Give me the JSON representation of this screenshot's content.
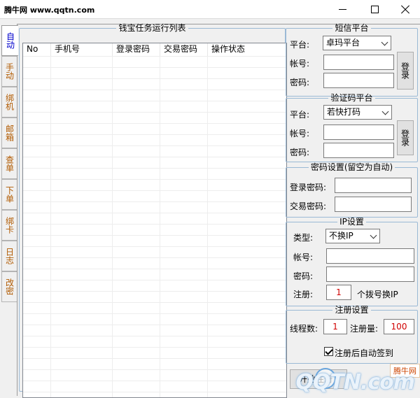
{
  "window": {
    "title": "腾牛网 www.qqtn.com"
  },
  "tabs": [
    {
      "label": "自动",
      "active": true
    },
    {
      "label": "手动"
    },
    {
      "label": "绑机"
    },
    {
      "label": "邮箱"
    },
    {
      "label": "查单"
    },
    {
      "label": "下单"
    },
    {
      "label": "绑卡"
    },
    {
      "label": "日志"
    },
    {
      "label": "改密"
    }
  ],
  "task_list": {
    "title": "钱宝任务运行列表",
    "columns": [
      "No",
      "手机号",
      "登录密码",
      "交易密码",
      "操作状态"
    ]
  },
  "sms_platform": {
    "title": "短信平台",
    "platform_label": "平台:",
    "platform_value": "卓玛平台",
    "account_label": "帐号:",
    "account_value": "",
    "password_label": "密码:",
    "password_value": "",
    "login_button": "登录"
  },
  "captcha_platform": {
    "title": "验证码平台",
    "platform_label": "平台:",
    "platform_value": "若快打码",
    "account_label": "帐号:",
    "account_value": "",
    "password_label": "密码:",
    "password_value": "",
    "login_button": "登录"
  },
  "password_settings": {
    "title": "密码设置(留空为自动)",
    "login_label": "登录密码:",
    "login_value": "",
    "trade_label": "交易密码:",
    "trade_value": ""
  },
  "ip_settings": {
    "title": "IP设置",
    "type_label": "类型:",
    "type_value": "不换IP",
    "account_label": "帐号:",
    "account_value": "",
    "password_label": "密码:",
    "password_value": "",
    "register_label": "注册:",
    "register_value": "1",
    "register_suffix": "个拨号换IP"
  },
  "register_settings": {
    "title": "注册设置",
    "threads_label": "线程数:",
    "threads_value": "1",
    "count_label": "注册量:",
    "count_value": "100",
    "auto_checkin_label": "注册后自动签到",
    "auto_checkin_checked": true
  },
  "bottom": {
    "start_button": "开始注册"
  },
  "watermark": {
    "badge": "腾牛网",
    "text": "QQTN.com"
  },
  "colors": {
    "tab_text": "#b15a00",
    "tab_active_text": "#0000cc",
    "group_border": "#9ab9d5",
    "red_value": "#d00000"
  }
}
